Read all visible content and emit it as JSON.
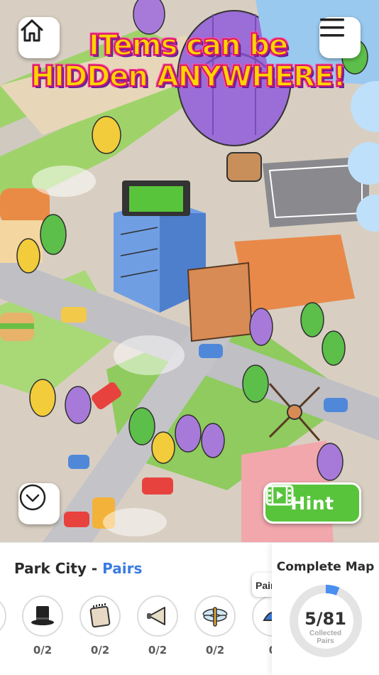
{
  "banner": {
    "line1": "ITems can be",
    "line2": "HIDDen ANYWHERE!"
  },
  "top_buttons": {
    "home_icon": "home-icon",
    "menu_icon": "hamburger-menu-icon"
  },
  "scene_controls": {
    "collapse_icon": "chevron-down-icon",
    "hint_label": "Hint",
    "hint_icon": "film-strip-icon"
  },
  "level": {
    "name": "Park City",
    "separator": " - ",
    "mode": "Pairs"
  },
  "pairs_tab": {
    "label": "Pairs"
  },
  "items": [
    {
      "icon": "partial-item-icon",
      "count": ""
    },
    {
      "icon": "top-hat-icon",
      "count": "0/2"
    },
    {
      "icon": "notepad-icon",
      "count": "0/2"
    },
    {
      "icon": "megaphone-icon",
      "count": "0/2"
    },
    {
      "icon": "dragonfly-icon",
      "count": "0/2"
    },
    {
      "icon": "blue-item-icon",
      "count": "0"
    }
  ],
  "complete_map": {
    "label": "Complete Map",
    "collected": 5,
    "total": 81,
    "count_text": "5/81",
    "sub_line1": "Collected",
    "sub_line2": "Pairs"
  },
  "colors": {
    "hint_green": "#58c43c",
    "mode_blue": "#3a7be0",
    "progress_blue": "#4a8ef0",
    "ring_gray": "#e4e4e4",
    "banner_yellow": "#ffd400",
    "banner_pink": "#d1196b"
  }
}
